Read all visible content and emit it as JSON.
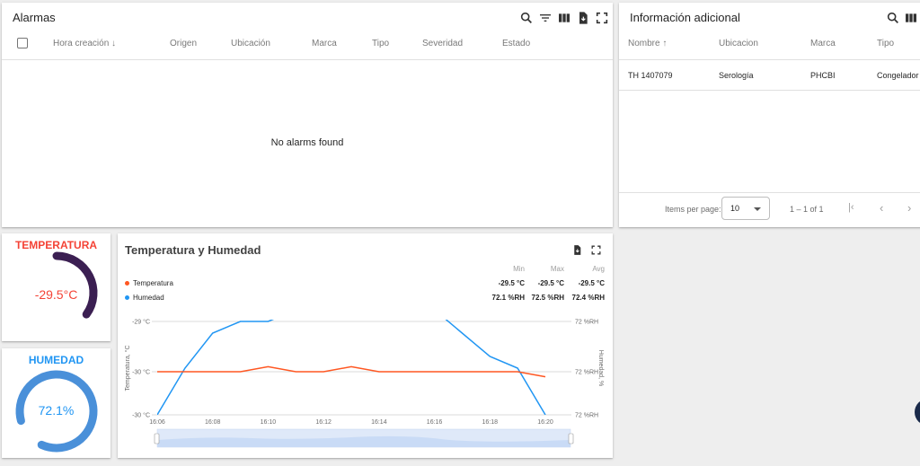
{
  "alarms": {
    "title": "Alarmas",
    "columns": [
      "Hora creación",
      "Origen",
      "Ubicación",
      "Marca",
      "Tipo",
      "Severidad",
      "Estado"
    ],
    "empty_message": "No alarms found"
  },
  "info": {
    "title": "Información adicional",
    "columns": [
      "Nombre",
      "Ubicacion",
      "Marca",
      "Tipo"
    ],
    "rows": [
      {
        "nombre": "TH 1407079",
        "ubicacion": "Serología",
        "marca": "PHCBI",
        "tipo": "Congelador"
      }
    ],
    "items_per_page_label": "Items per page:",
    "items_per_page_value": "10",
    "range_label": "1 – 1 of 1"
  },
  "temp_gauge": {
    "title": "TEMPERATURA",
    "value": "-29.5°C",
    "level": 0.35,
    "title_color": "#f44336",
    "arc_color": "#3b1f52"
  },
  "hum_gauge": {
    "title": "HUMEDAD",
    "value": "72.1%",
    "level": 0.72,
    "title_color": "#2196f3",
    "arc_color": "#4a90d9"
  },
  "chart": {
    "title": "Temperatura y Humedad",
    "stat_headers": [
      "Min",
      "Max",
      "Avg"
    ],
    "series_labels": [
      "Temperatura",
      "Humedad"
    ],
    "temp_stats": [
      "-29.5 °C",
      "-29.5 °C",
      "-29.5 °C"
    ],
    "hum_stats": [
      "72.1 %RH",
      "72.5 %RH",
      "72.4 %RH"
    ],
    "left_axis_label": "Temperatura, °C",
    "right_axis_label": "Humedad, %",
    "left_ticks": [
      "-29 °C",
      "-30 °C",
      "-30 °C"
    ],
    "right_ticks": [
      "72 %RH",
      "72 %RH",
      "72 %RH"
    ],
    "x_ticks": [
      "16:06",
      "16:08",
      "16:10",
      "16:12",
      "16:14",
      "16:16",
      "16:18",
      "16:20"
    ],
    "temp_color": "#ff5722",
    "hum_color": "#2196f3"
  },
  "chart_data": {
    "type": "line",
    "x": [
      "16:06",
      "16:07",
      "16:08",
      "16:09",
      "16:10",
      "16:11",
      "16:12",
      "16:13",
      "16:14",
      "16:15",
      "16:16",
      "16:17",
      "16:18",
      "16:19",
      "16:20"
    ],
    "series": [
      {
        "name": "Temperatura",
        "values": [
          -30.0,
          -30.0,
          -30.0,
          -30.0,
          -29.9,
          -30.0,
          -30.0,
          -29.9,
          -30.0,
          -30.0,
          -30.0,
          -30.0,
          -30.0,
          -30.0,
          -30.1
        ]
      },
      {
        "name": "Humedad",
        "values": [
          72.1,
          72.3,
          72.45,
          72.5,
          72.5,
          72.55,
          72.6,
          null,
          null,
          null,
          72.55,
          72.45,
          72.35,
          72.3,
          72.1
        ]
      }
    ],
    "xlabel": "",
    "ylabel": "Temperatura, °C",
    "y2label": "Humedad, %",
    "grid": true
  }
}
